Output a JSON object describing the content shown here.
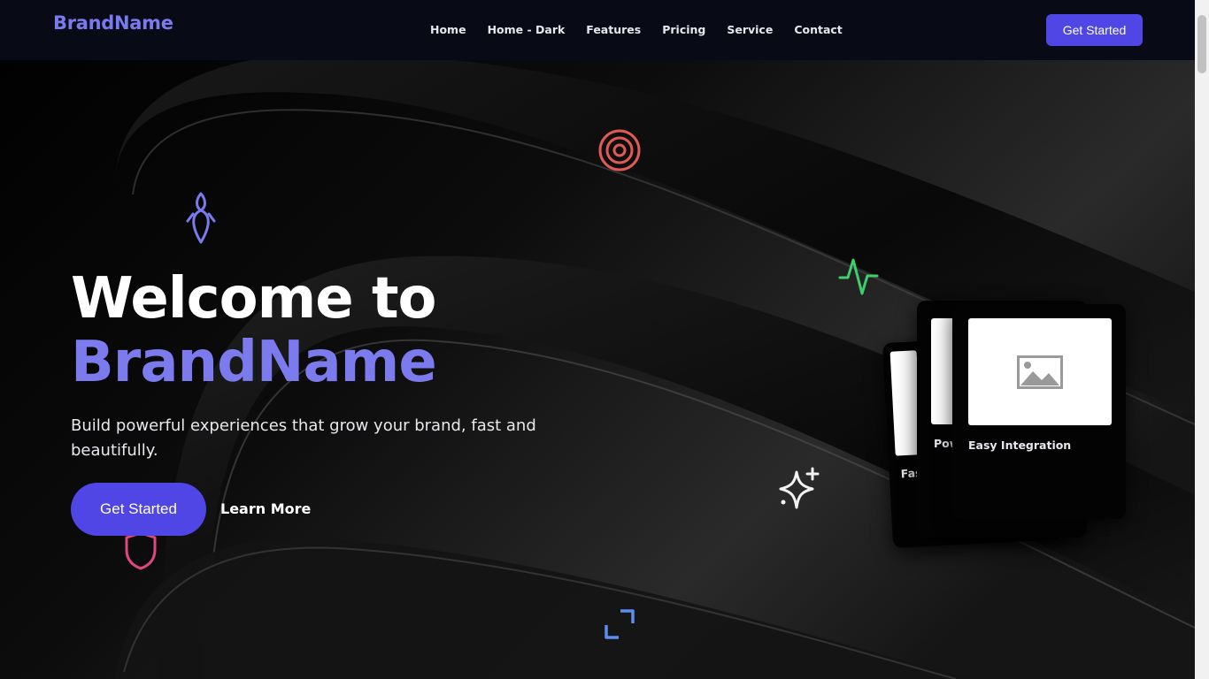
{
  "navbar": {
    "brand": "BrandName",
    "links": [
      "Home",
      "Home - Dark",
      "Features",
      "Pricing",
      "Service",
      "Contact"
    ],
    "cta_label": "Get Started"
  },
  "hero": {
    "title_line1": "Welcome to",
    "title_line2": "BrandName",
    "subtitle": "Build powerful experiences that grow your brand, fast and beautifully.",
    "primary_cta": "Get Started",
    "secondary_cta": "Learn More"
  },
  "cards": [
    {
      "label": "Fast"
    },
    {
      "label": "Pow"
    },
    {
      "label": "Easy Integration"
    }
  ],
  "icons": [
    "rocket-icon",
    "target-icon",
    "pulse-icon",
    "sparkles-icon",
    "shield-icon",
    "expand-icon",
    "image-placeholder-icon"
  ],
  "colors": {
    "brand": "#7b79ee",
    "accent": "#4f46e5",
    "background": "#000000",
    "navbar": "#080b16",
    "target": "#e05a56",
    "pulse": "#3ecf6a",
    "shield": "#e0467f",
    "expand": "#5b8ef0"
  }
}
